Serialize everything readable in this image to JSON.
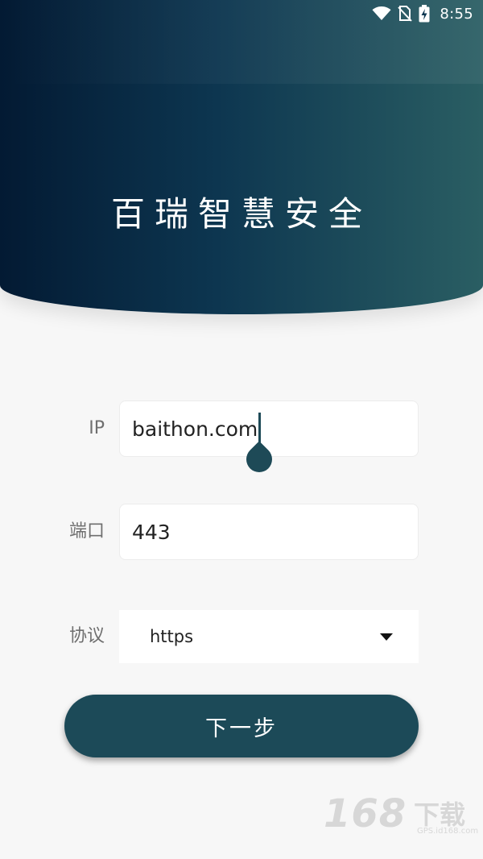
{
  "status_bar": {
    "time": "8:55",
    "icons": [
      "wifi-icon",
      "no-sim-icon",
      "battery-charging-icon"
    ]
  },
  "header": {
    "title": "百瑞智慧安全",
    "colors": {
      "gradient_start": "#031a33",
      "gradient_end": "#2a5e63"
    }
  },
  "form": {
    "ip": {
      "label": "IP",
      "value": "baithon.com"
    },
    "port": {
      "label": "端口",
      "value": "443"
    },
    "protocol": {
      "label": "协议",
      "selected": "https"
    }
  },
  "next_button": {
    "label": "下一步"
  },
  "watermark": {
    "main": "168",
    "cn": "下载",
    "small": "GPS.id168.com"
  },
  "colors": {
    "accent": "#1c4a58",
    "background": "#f7f7f7"
  }
}
